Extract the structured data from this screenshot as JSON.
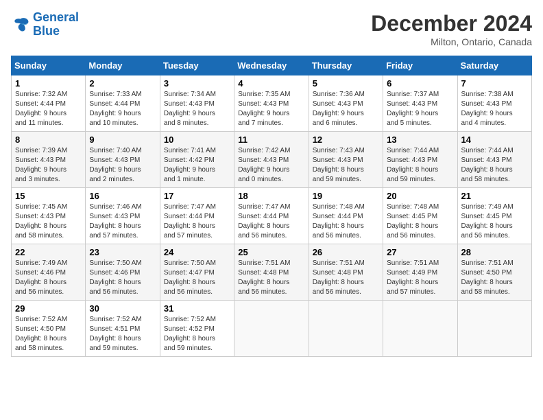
{
  "logo": {
    "line1": "General",
    "line2": "Blue"
  },
  "title": "December 2024",
  "location": "Milton, Ontario, Canada",
  "days_header": [
    "Sunday",
    "Monday",
    "Tuesday",
    "Wednesday",
    "Thursday",
    "Friday",
    "Saturday"
  ],
  "weeks": [
    [
      {
        "day": "1",
        "info": "Sunrise: 7:32 AM\nSunset: 4:44 PM\nDaylight: 9 hours\nand 11 minutes."
      },
      {
        "day": "2",
        "info": "Sunrise: 7:33 AM\nSunset: 4:44 PM\nDaylight: 9 hours\nand 10 minutes."
      },
      {
        "day": "3",
        "info": "Sunrise: 7:34 AM\nSunset: 4:43 PM\nDaylight: 9 hours\nand 8 minutes."
      },
      {
        "day": "4",
        "info": "Sunrise: 7:35 AM\nSunset: 4:43 PM\nDaylight: 9 hours\nand 7 minutes."
      },
      {
        "day": "5",
        "info": "Sunrise: 7:36 AM\nSunset: 4:43 PM\nDaylight: 9 hours\nand 6 minutes."
      },
      {
        "day": "6",
        "info": "Sunrise: 7:37 AM\nSunset: 4:43 PM\nDaylight: 9 hours\nand 5 minutes."
      },
      {
        "day": "7",
        "info": "Sunrise: 7:38 AM\nSunset: 4:43 PM\nDaylight: 9 hours\nand 4 minutes."
      }
    ],
    [
      {
        "day": "8",
        "info": "Sunrise: 7:39 AM\nSunset: 4:43 PM\nDaylight: 9 hours\nand 3 minutes."
      },
      {
        "day": "9",
        "info": "Sunrise: 7:40 AM\nSunset: 4:43 PM\nDaylight: 9 hours\nand 2 minutes."
      },
      {
        "day": "10",
        "info": "Sunrise: 7:41 AM\nSunset: 4:42 PM\nDaylight: 9 hours\nand 1 minute."
      },
      {
        "day": "11",
        "info": "Sunrise: 7:42 AM\nSunset: 4:43 PM\nDaylight: 9 hours\nand 0 minutes."
      },
      {
        "day": "12",
        "info": "Sunrise: 7:43 AM\nSunset: 4:43 PM\nDaylight: 8 hours\nand 59 minutes."
      },
      {
        "day": "13",
        "info": "Sunrise: 7:44 AM\nSunset: 4:43 PM\nDaylight: 8 hours\nand 59 minutes."
      },
      {
        "day": "14",
        "info": "Sunrise: 7:44 AM\nSunset: 4:43 PM\nDaylight: 8 hours\nand 58 minutes."
      }
    ],
    [
      {
        "day": "15",
        "info": "Sunrise: 7:45 AM\nSunset: 4:43 PM\nDaylight: 8 hours\nand 58 minutes."
      },
      {
        "day": "16",
        "info": "Sunrise: 7:46 AM\nSunset: 4:43 PM\nDaylight: 8 hours\nand 57 minutes."
      },
      {
        "day": "17",
        "info": "Sunrise: 7:47 AM\nSunset: 4:44 PM\nDaylight: 8 hours\nand 57 minutes."
      },
      {
        "day": "18",
        "info": "Sunrise: 7:47 AM\nSunset: 4:44 PM\nDaylight: 8 hours\nand 56 minutes."
      },
      {
        "day": "19",
        "info": "Sunrise: 7:48 AM\nSunset: 4:44 PM\nDaylight: 8 hours\nand 56 minutes."
      },
      {
        "day": "20",
        "info": "Sunrise: 7:48 AM\nSunset: 4:45 PM\nDaylight: 8 hours\nand 56 minutes."
      },
      {
        "day": "21",
        "info": "Sunrise: 7:49 AM\nSunset: 4:45 PM\nDaylight: 8 hours\nand 56 minutes."
      }
    ],
    [
      {
        "day": "22",
        "info": "Sunrise: 7:49 AM\nSunset: 4:46 PM\nDaylight: 8 hours\nand 56 minutes."
      },
      {
        "day": "23",
        "info": "Sunrise: 7:50 AM\nSunset: 4:46 PM\nDaylight: 8 hours\nand 56 minutes."
      },
      {
        "day": "24",
        "info": "Sunrise: 7:50 AM\nSunset: 4:47 PM\nDaylight: 8 hours\nand 56 minutes."
      },
      {
        "day": "25",
        "info": "Sunrise: 7:51 AM\nSunset: 4:48 PM\nDaylight: 8 hours\nand 56 minutes."
      },
      {
        "day": "26",
        "info": "Sunrise: 7:51 AM\nSunset: 4:48 PM\nDaylight: 8 hours\nand 56 minutes."
      },
      {
        "day": "27",
        "info": "Sunrise: 7:51 AM\nSunset: 4:49 PM\nDaylight: 8 hours\nand 57 minutes."
      },
      {
        "day": "28",
        "info": "Sunrise: 7:51 AM\nSunset: 4:50 PM\nDaylight: 8 hours\nand 58 minutes."
      }
    ],
    [
      {
        "day": "29",
        "info": "Sunrise: 7:52 AM\nSunset: 4:50 PM\nDaylight: 8 hours\nand 58 minutes."
      },
      {
        "day": "30",
        "info": "Sunrise: 7:52 AM\nSunset: 4:51 PM\nDaylight: 8 hours\nand 59 minutes."
      },
      {
        "day": "31",
        "info": "Sunrise: 7:52 AM\nSunset: 4:52 PM\nDaylight: 8 hours\nand 59 minutes."
      },
      null,
      null,
      null,
      null
    ]
  ]
}
